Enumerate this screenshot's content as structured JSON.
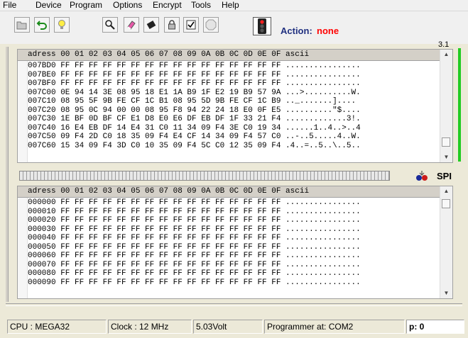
{
  "menu": [
    "File",
    "Device",
    "Program",
    "Options",
    "Encrypt",
    "Tools",
    "Help"
  ],
  "toolbar": {
    "icons": [
      "open-icon",
      "undo-icon",
      "bulb-icon",
      "search-icon",
      "eraser-icon",
      "chip-icon",
      "lock-icon",
      "checklist-icon",
      "stop-icon"
    ],
    "action_label": "Action:",
    "action_value": "none",
    "version": "3.1"
  },
  "top_panel": {
    "header": "adress 00 01 02 03 04 05 06 07 08 09 0A 0B 0C 0D 0E 0F ascii",
    "rows": [
      "007BD0 FF FF FF FF FF FF FF FF FF FF FF FF FF FF FF FF ................",
      "007BE0 FF FF FF FF FF FF FF FF FF FF FF FF FF FF FF FF ................",
      "007BF0 FF FF FF FF FF FF FF FF FF FF FF FF FF FF FF FF ................",
      "007C00 0E 94 14 3E 08 95 18 E1 1A B9 1F E2 19 B9 57 9A ...>..........W.",
      "007C10 08 95 5F 9B FE CF 1C B1 08 95 5D 9B FE CF 1C B9 .._.......]....",
      "007C20 08 95 0C 94 00 00 08 95 F8 94 22 24 18 E0 0F E5 ..........\"$....",
      "007C30 1E BF 0D BF CF E1 D8 E0 E6 DF EB DF 1F 33 21 F4 .............3!.",
      "007C40 16 E4 EB DF 14 E4 31 C0 11 34 09 F4 3E C0 19 34 ......1..4..>..4",
      "007C50 09 F4 2D C0 18 35 09 F4 E4 CF 14 34 09 F4 57 C0 ..-..5.....4..W.",
      "007C60 15 34 09 F4 3D C0 10 35 09 F4 5C C0 12 35 09 F4 .4..=..5..\\..5.."
    ]
  },
  "progress": {
    "value": 0
  },
  "mode": "SPI",
  "bottom_panel": {
    "header": "adress 00 01 02 03 04 05 06 07 08 09 0A 0B 0C 0D 0E 0F ascii",
    "rows": [
      "000000 FF FF FF FF FF FF FF FF FF FF FF FF FF FF FF FF ................",
      "000010 FF FF FF FF FF FF FF FF FF FF FF FF FF FF FF FF ................",
      "000020 FF FF FF FF FF FF FF FF FF FF FF FF FF FF FF FF ................",
      "000030 FF FF FF FF FF FF FF FF FF FF FF FF FF FF FF FF ................",
      "000040 FF FF FF FF FF FF FF FF FF FF FF FF FF FF FF FF ................",
      "000050 FF FF FF FF FF FF FF FF FF FF FF FF FF FF FF FF ................",
      "000060 FF FF FF FF FF FF FF FF FF FF FF FF FF FF FF FF ................",
      "000070 FF FF FF FF FF FF FF FF FF FF FF FF FF FF FF FF ................",
      "000080 FF FF FF FF FF FF FF FF FF FF FF FF FF FF FF FF ................",
      "000090 FF FF FF FF FF FF FF FF FF FF FF FF FF FF FF FF ................"
    ]
  },
  "status": {
    "cpu": "CPU : MEGA32",
    "clock": "Clock : 12 MHz",
    "voltage": "5.03Volt",
    "programmer": "Programmer at: COM2",
    "position": "p: 0"
  },
  "colors": {
    "action_label": "#203080",
    "action_value": "#ff0000",
    "activity_bar": "#22cc22"
  }
}
